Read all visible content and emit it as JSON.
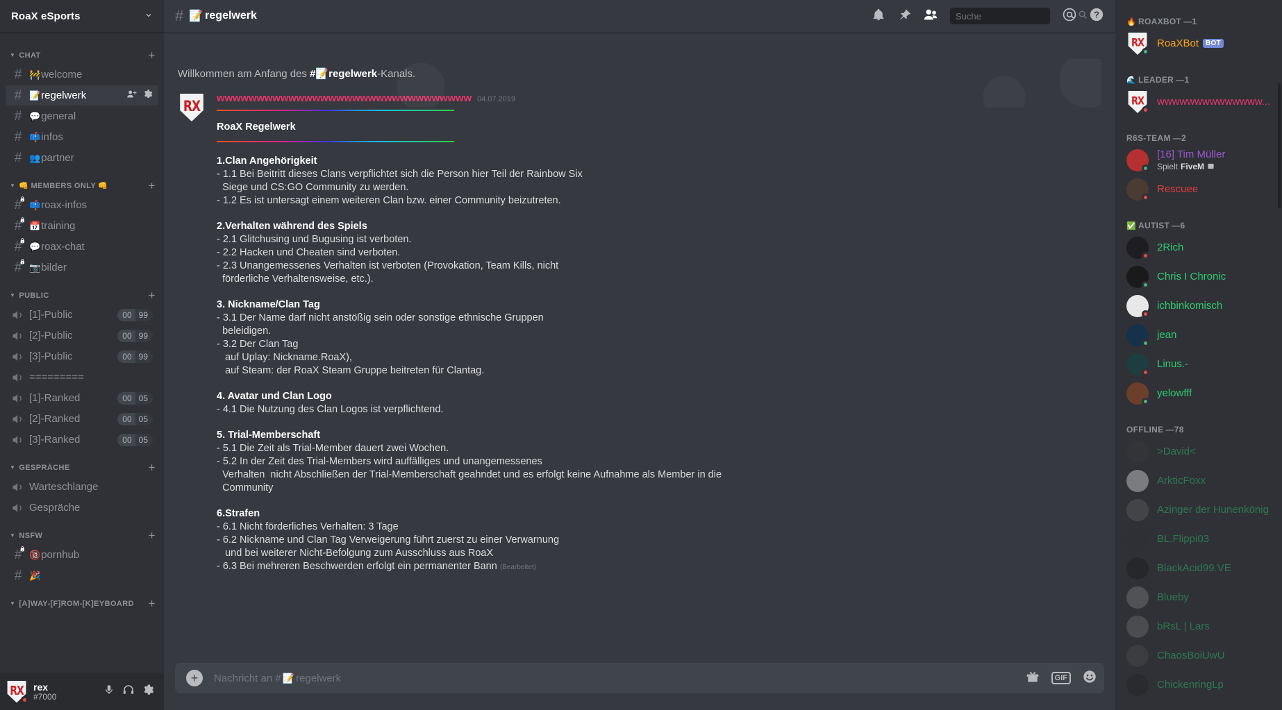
{
  "guild": {
    "name": "RoaX eSports"
  },
  "sidebar": {
    "categories": [
      {
        "id": "chat",
        "label": "CHAT",
        "emoji_prefix": "",
        "emoji_suffix": "",
        "channels": [
          {
            "name": "welcome",
            "emoji": "🚧",
            "type": "text",
            "locked": false,
            "active": false
          },
          {
            "name": "regelwerk",
            "emoji": "📝",
            "type": "text",
            "locked": false,
            "active": true
          },
          {
            "name": "general",
            "emoji": "💬",
            "type": "text",
            "locked": false,
            "active": false
          },
          {
            "name": "infos",
            "emoji": "📫",
            "type": "text",
            "locked": false,
            "active": false
          },
          {
            "name": "partner",
            "emoji": "👥",
            "type": "text",
            "locked": false,
            "active": false
          }
        ]
      },
      {
        "id": "members-only",
        "label": "MEMBERS ONLY",
        "emoji_prefix": "👊",
        "emoji_suffix": "👊",
        "channels": [
          {
            "name": "roax-infos",
            "emoji": "📫",
            "type": "text",
            "locked": true,
            "active": false
          },
          {
            "name": "training",
            "emoji": "📅",
            "type": "text",
            "locked": true,
            "active": false
          },
          {
            "name": "roax-chat",
            "emoji": "💬",
            "type": "text",
            "locked": true,
            "active": false
          },
          {
            "name": "bilder",
            "emoji": "📷",
            "type": "text",
            "locked": true,
            "active": false
          }
        ]
      },
      {
        "id": "public",
        "label": "PUBLIC",
        "emoji_prefix": "",
        "emoji_suffix": "",
        "channels": [
          {
            "name": "[1]-Public",
            "emoji": "",
            "type": "voice",
            "locked": false,
            "active": false,
            "used": "00",
            "limit": "99"
          },
          {
            "name": "[2]-Public",
            "emoji": "",
            "type": "voice",
            "locked": false,
            "active": false,
            "used": "00",
            "limit": "99"
          },
          {
            "name": "[3]-Public",
            "emoji": "",
            "type": "voice",
            "locked": false,
            "active": false,
            "used": "00",
            "limit": "99"
          },
          {
            "name": "=========",
            "emoji": "",
            "type": "voice",
            "locked": true,
            "active": false
          },
          {
            "name": "[1]-Ranked",
            "emoji": "",
            "type": "voice",
            "locked": false,
            "active": false,
            "used": "00",
            "limit": "05"
          },
          {
            "name": "[2]-Ranked",
            "emoji": "",
            "type": "voice",
            "locked": false,
            "active": false,
            "used": "00",
            "limit": "05"
          },
          {
            "name": "[3]-Ranked",
            "emoji": "",
            "type": "voice",
            "locked": false,
            "active": false,
            "used": "00",
            "limit": "05"
          }
        ]
      },
      {
        "id": "gespraeche",
        "label": "GESPRÄCHE",
        "emoji_prefix": "",
        "emoji_suffix": "",
        "channels": [
          {
            "name": "Warteschlange",
            "emoji": "",
            "type": "voice",
            "locked": false,
            "active": false
          },
          {
            "name": "Gespräche",
            "emoji": "",
            "type": "voice",
            "locked": true,
            "active": false
          }
        ]
      },
      {
        "id": "nsfw",
        "label": "NSFW",
        "emoji_prefix": "",
        "emoji_suffix": "",
        "channels": [
          {
            "name": "pornhub",
            "emoji": "🔞",
            "type": "text",
            "locked": true,
            "active": false
          },
          {
            "name": "",
            "emoji": "🎉",
            "type": "text",
            "locked": false,
            "active": false
          }
        ]
      },
      {
        "id": "afk",
        "label": "[A]WAY-[F]ROM-[K]EYBOARD",
        "emoji_prefix": "",
        "emoji_suffix": "",
        "channels": []
      }
    ],
    "add_channel_label": "+",
    "user": {
      "name": "rex",
      "discriminator": "#7000",
      "status": "dnd",
      "mic_icon": "microphone-icon",
      "headset_icon": "headset-icon",
      "settings_icon": "gear-icon"
    }
  },
  "topbar": {
    "hash": "#",
    "channel_emoji": "📝",
    "channel_name": "regelwerk",
    "icons": [
      "bell-icon",
      "pin-icon",
      "members-icon",
      "mention-icon",
      "help-icon"
    ],
    "search": {
      "placeholder": "Suche",
      "value": ""
    }
  },
  "chat": {
    "welcome_prefix": "Willkommen am Anfang des ",
    "welcome_hash": "#",
    "welcome_emoji": "📝",
    "welcome_channel": "regelwerk",
    "welcome_suffix": "-Kanals.",
    "message": {
      "author": "wwwwwwwwwwwwwwwwwwwwwwwwwwwwwwww",
      "author_color": "#e5376b",
      "timestamp": "04.07.2019",
      "title": "RoaX Regelwerk",
      "edited_label": "(Bearbeitet)",
      "sections": [
        {
          "heading": "1.Clan Angehörigkeit",
          "lines": [
            "- 1.1 Bei Beitritt dieses Clans verpflichtet sich die Person hier Teil der Rainbow Six",
            "  Siege und CS:GO Community zu werden.",
            "- 1.2 Es ist untersagt einem weiteren Clan bzw. einer Community beizutreten."
          ]
        },
        {
          "heading": "2.Verhalten während des Spiels",
          "lines": [
            "- 2.1 Glitchusing und Bugusing ist verboten.",
            "- 2.2 Hacken und Cheaten sind verboten.",
            "- 2.3 Unangemessenes Verhalten ist verboten (Provokation, Team Kills, nicht",
            "  förderliche Verhaltensweise, etc.)."
          ]
        },
        {
          "heading": "3. Nickname/Clan Tag",
          "lines": [
            "- 3.1 Der Name darf nicht anstößig sein oder sonstige ethnische Gruppen",
            "  beleidigen.",
            "- 3.2 Der Clan Tag",
            "   auf Uplay: Nickname.RoaX),",
            "   auf Steam: der RoaX Steam Gruppe beitreten für Clantag."
          ]
        },
        {
          "heading": "4. Avatar und Clan Logo",
          "lines": [
            "- 4.1 Die Nutzung des Clan Logos ist verpflichtend."
          ]
        },
        {
          "heading": "5. Trial-Memberschaft",
          "lines": [
            "- 5.1 Die Zeit als Trial-Member dauert zwei Wochen.",
            "- 5.2 In der Zeit des Trial-Members wird auffälliges und unangemessenes",
            "  Verhalten  nicht Abschließen der Trial-Memberschaft geahndet und es erfolgt keine Aufnahme als Member in die",
            "  Community"
          ]
        },
        {
          "heading": "6.Strafen",
          "lines": [
            "- 6.1 Nicht förderliches Verhalten: 3 Tage",
            "- 6.2 Nickname und Clan Tag Verweigerung führt zuerst zu einer Verwarnung",
            "   und bei weiterer Nicht-Befolgung zum Ausschluss aus RoaX"
          ],
          "last_line": "- 6.3 Bei mehreren Beschwerden erfolgt ein permanenter Bann"
        }
      ]
    },
    "composer": {
      "placeholder_prefix": "Nachricht an #",
      "placeholder_emoji": "📝",
      "placeholder_channel": "regelwerk",
      "value": "",
      "gif_label": "GIF"
    }
  },
  "members": {
    "groups": [
      {
        "emoji": "🔥",
        "label": "ROAXBOT",
        "count": "1",
        "members": [
          {
            "name": "RoaXBot",
            "color": "#faa61a",
            "status": "online",
            "bot": true,
            "bot_label": "BOT",
            "avatar": "roax",
            "sub": ""
          }
        ]
      },
      {
        "emoji": "🌊",
        "label": "LEADER",
        "count": "1",
        "members": [
          {
            "name": "wwwwwwwwwwwwww...",
            "color": "#e5376b",
            "status": "dnd",
            "bot": false,
            "avatar": "roax",
            "sub": ""
          }
        ]
      },
      {
        "emoji": "",
        "label": "R6S-TEAM",
        "count": "2",
        "members": [
          {
            "name": "[16] Tim Müller",
            "color": "#9b59d0",
            "status": "online",
            "bot": false,
            "avatar": "#b53030",
            "sub_prefix": "Spielt ",
            "sub": "FiveM"
          },
          {
            "name": "Rescuee",
            "color": "#e03e3e",
            "status": "dnd",
            "bot": false,
            "avatar": "#4a3b33",
            "sub": ""
          }
        ]
      },
      {
        "emoji": "✅",
        "label": "AUTIST",
        "count": "6",
        "members": [
          {
            "name": "2Rich",
            "color": "#2ecc71",
            "status": "dnd",
            "bot": false,
            "avatar": "#1d1d22",
            "sub": ""
          },
          {
            "name": "Chris I Chronic",
            "color": "#2ecc71",
            "status": "online",
            "bot": false,
            "avatar": "#1a1a1a",
            "sub": ""
          },
          {
            "name": "ichbinkomisch",
            "color": "#2ecc71",
            "status": "dnd",
            "bot": false,
            "avatar": "#e8e8e8",
            "sub": ""
          },
          {
            "name": "jean",
            "color": "#2ecc71",
            "status": "online",
            "bot": false,
            "avatar": "#15324a",
            "sub": ""
          },
          {
            "name": "Linus.-",
            "color": "#2ecc71",
            "status": "dnd",
            "bot": false,
            "avatar": "#1d3d40",
            "sub": ""
          },
          {
            "name": "yelowfff",
            "color": "#2ecc71",
            "status": "online",
            "bot": false,
            "avatar": "#6b3f2a",
            "sub": ""
          }
        ]
      },
      {
        "emoji": "",
        "label": "OFFLINE",
        "count": "78",
        "offline": true,
        "members": [
          {
            "name": ">David<",
            "color": "#2ecc71",
            "status": "offline",
            "bot": false,
            "avatar": "#3a3a3a",
            "sub": ""
          },
          {
            "name": "ArkticFoxx",
            "color": "#2ecc71",
            "status": "offline",
            "bot": false,
            "avatar": "#d8d8d8",
            "sub": ""
          },
          {
            "name": "Azinger der Hunenkönig",
            "color": "#2ecc71",
            "status": "offline",
            "bot": false,
            "avatar": "#5d5d5d",
            "sub": ""
          },
          {
            "name": "BL.Flippi03",
            "color": "#2ecc71",
            "status": "offline",
            "bot": false,
            "avatar": "#2f3136",
            "sub": ""
          },
          {
            "name": "BlackAcid99.VE",
            "color": "#2ecc71",
            "status": "offline",
            "bot": false,
            "avatar": "#1c1c1c",
            "sub": ""
          },
          {
            "name": "Blueby",
            "color": "#2ecc71",
            "status": "offline",
            "bot": false,
            "avatar": "#7c7c7c",
            "sub": ""
          },
          {
            "name": "bRsL | Lars",
            "color": "#2ecc71",
            "status": "offline",
            "bot": false,
            "avatar": "#6e6e6e",
            "sub": ""
          },
          {
            "name": "ChaosBoiUwU",
            "color": "#2ecc71",
            "status": "offline",
            "bot": false,
            "avatar": "#4c4c4c",
            "sub": ""
          },
          {
            "name": "ChickenringLp",
            "color": "#2ecc71",
            "status": "offline",
            "bot": false,
            "avatar": "#262626",
            "sub": ""
          }
        ]
      }
    ]
  }
}
